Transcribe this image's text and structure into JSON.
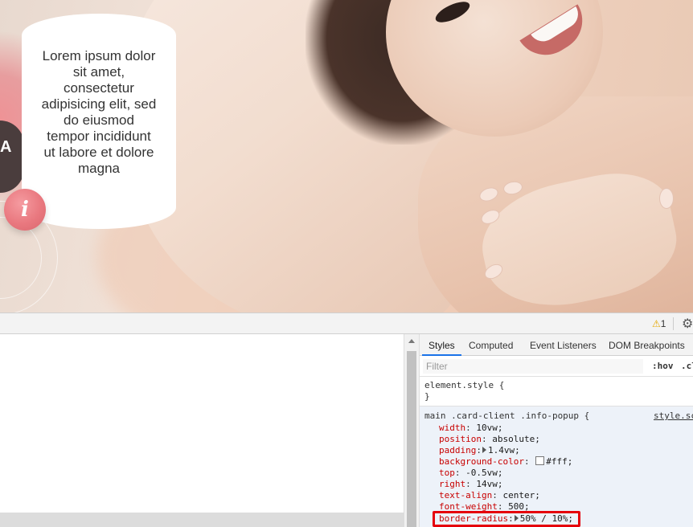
{
  "page": {
    "popup_text": "Lorem ipsum dolor sit amet, consectetur adipisicing elit, sed do eiusmod tempor incididunt ut labore et dolore magna",
    "info_button_label": "i",
    "bg_letter": "A"
  },
  "devtools": {
    "warning_count": "1",
    "tabs": [
      "Styles",
      "Computed",
      "Event Listeners",
      "DOM Breakpoints"
    ],
    "active_tab": "Styles",
    "filter_placeholder": "Filter",
    "hov_label": ":hov",
    "cls_label": ".cl",
    "element_style_open": "element.style {",
    "element_style_close": "}",
    "rule": {
      "selector": "main .card-client .info-popup {",
      "source": "style.sc",
      "declarations": [
        {
          "name": "width",
          "value": "10vw;"
        },
        {
          "name": "position",
          "value": "absolute;"
        },
        {
          "name": "padding",
          "value": "1.4vw;"
        },
        {
          "name": "background-color",
          "value": "#fff;"
        },
        {
          "name": "top",
          "value": "-0.5vw;"
        },
        {
          "name": "right",
          "value": "14vw;"
        },
        {
          "name": "text-align",
          "value": "center;"
        },
        {
          "name": "font-weight",
          "value": "500;"
        },
        {
          "name": "border-radius",
          "value": "50% / 10%;"
        }
      ]
    },
    "colors": {
      "accent": "#1a73e8",
      "highlight": "#e5000a",
      "property_name": "#c80000",
      "info_button": "#e9787f"
    }
  }
}
